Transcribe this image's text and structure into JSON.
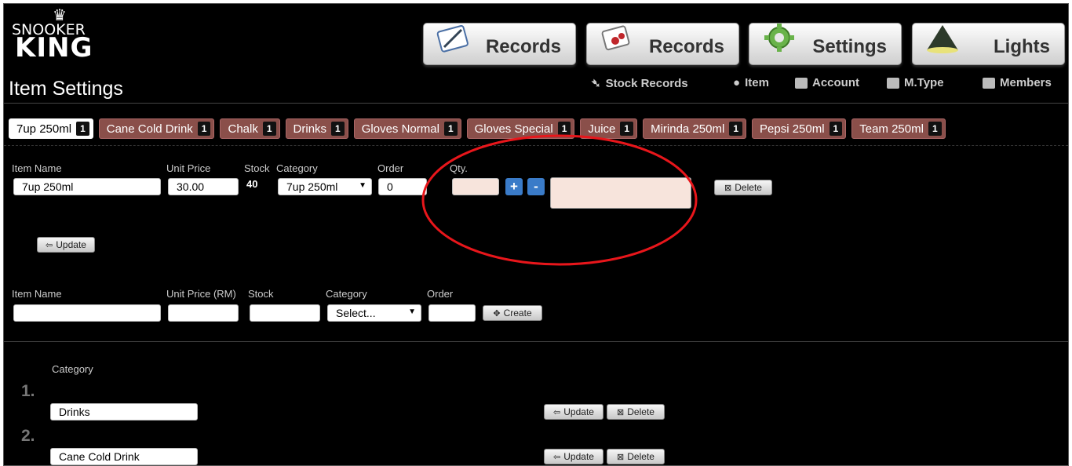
{
  "logo": {
    "line1": "SNOOKER",
    "line2": "KING",
    "crown": "♛"
  },
  "page_title": "Item Settings",
  "topnav": [
    {
      "label": "Records",
      "icon": "notepad-pen-icon"
    },
    {
      "label": "Records",
      "icon": "card-icon"
    },
    {
      "label": "Settings",
      "icon": "gear-icon"
    },
    {
      "label": "Lights",
      "icon": "lamp-icon"
    }
  ],
  "subnav": [
    {
      "label": "Stock Records",
      "icon": "stock-icon"
    },
    {
      "label": "Item",
      "icon": "pin-icon"
    },
    {
      "label": "Account",
      "icon": "user-icon"
    },
    {
      "label": "M.Type",
      "icon": "card-type-icon"
    },
    {
      "label": "Members",
      "icon": "members-icon"
    }
  ],
  "tabs": [
    {
      "label": "7up 250ml",
      "count": "1",
      "active": true
    },
    {
      "label": "Cane Cold Drink",
      "count": "1"
    },
    {
      "label": "Chalk",
      "count": "1"
    },
    {
      "label": "Drinks",
      "count": "1"
    },
    {
      "label": "Gloves Normal",
      "count": "1"
    },
    {
      "label": "Gloves Special",
      "count": "1"
    },
    {
      "label": "Juice",
      "count": "1"
    },
    {
      "label": "Mirinda 250ml",
      "count": "1"
    },
    {
      "label": "Pepsi 250ml",
      "count": "1"
    },
    {
      "label": "Team 250ml",
      "count": "1"
    }
  ],
  "edit_form": {
    "labels": {
      "item_name": "Item Name",
      "unit_price": "Unit Price",
      "stock": "Stock",
      "category": "Category",
      "order": "Order",
      "qty": "Qty."
    },
    "item_name": "7up 250ml",
    "unit_price": "30.00",
    "stock": "40",
    "category": "7up 250ml",
    "order": "0",
    "qty": "",
    "plus": "+",
    "minus": "-",
    "delete_label": "Delete",
    "update_label": "Update"
  },
  "create_form": {
    "labels": {
      "item_name": "Item Name",
      "unit_price": "Unit Price (RM)",
      "stock": "Stock",
      "category": "Category",
      "order": "Order"
    },
    "category_placeholder": "Select...",
    "create_label": "Create"
  },
  "categories": {
    "header": "Category",
    "items": [
      {
        "num": "1.",
        "name": "Drinks",
        "update": "Update",
        "delete": "Delete"
      },
      {
        "num": "2.",
        "name": "Cane Cold Drink",
        "update": "Update",
        "delete": "Delete"
      }
    ]
  },
  "annotation_color": "#e8161b"
}
